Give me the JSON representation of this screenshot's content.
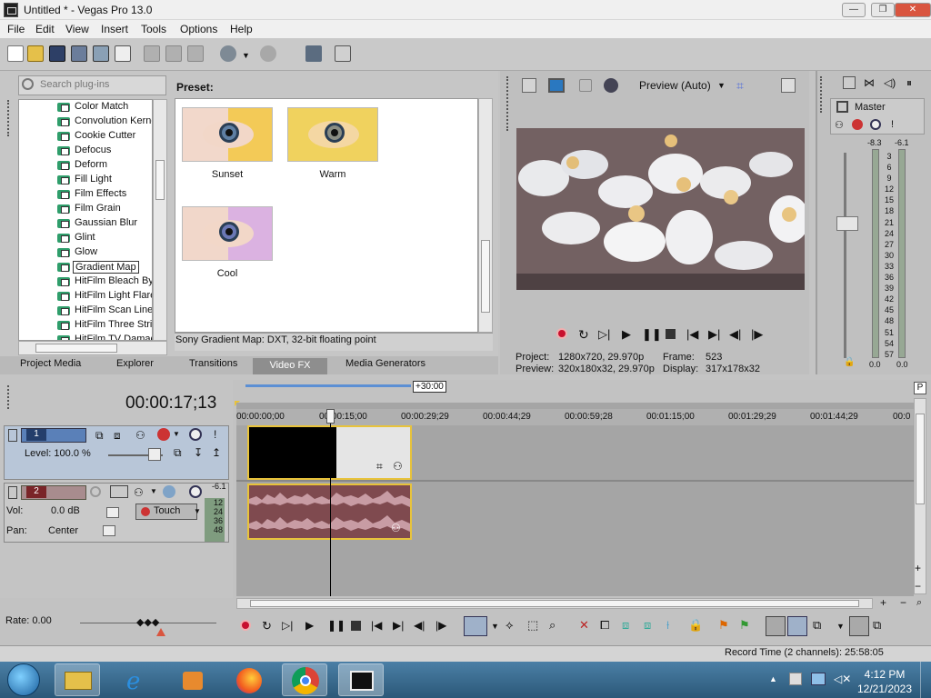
{
  "window": {
    "title": "Untitled * - Vegas Pro 13.0"
  },
  "menu": [
    "File",
    "Edit",
    "View",
    "Insert",
    "Tools",
    "Options",
    "Help"
  ],
  "fx_browser": {
    "search_placeholder": "Search plug-ins",
    "items": [
      "Color Match",
      "Convolution Kerne",
      "Cookie Cutter",
      "Defocus",
      "Deform",
      "Fill Light",
      "Film Effects",
      "Film Grain",
      "Gaussian Blur",
      "Glint",
      "Glow",
      "Gradient Map",
      "HitFilm Bleach Byp",
      "HitFilm Light Flares",
      "HitFilm Scan Lines",
      "HitFilm Three Strip",
      "HitFilm TV Damage"
    ],
    "selected": "Gradient Map",
    "preset_label": "Preset:",
    "presets": [
      {
        "name": "Sunset",
        "tint": "#f3c73a"
      },
      {
        "name": "Warm",
        "tint": "#f0d25e"
      },
      {
        "name": "Cool",
        "tint": "#d6a9e6"
      }
    ],
    "status": "Sony Gradient Map: DXT, 32-bit floating point",
    "tabs": [
      "Project Media",
      "Explorer",
      "Transitions",
      "Video FX",
      "Media Generators"
    ],
    "active_tab": "Video FX"
  },
  "preview": {
    "mode_label": "Preview (Auto)",
    "project_label": "Project:",
    "project_value": "1280x720, 29.970p",
    "preview_label": "Preview:",
    "preview_value": "320x180x32, 29.970p",
    "frame_label": "Frame:",
    "frame_value": "523",
    "display_label": "Display:",
    "display_value": "317x178x32"
  },
  "master": {
    "label": "Master",
    "peak_left": "-8.3",
    "peak_right": "-6.1",
    "scale": [
      "3",
      "6",
      "9",
      "12",
      "15",
      "18",
      "21",
      "24",
      "27",
      "30",
      "33",
      "36",
      "39",
      "42",
      "45",
      "48",
      "51",
      "54",
      "57"
    ],
    "bottom_left": "0.0",
    "bottom_right": "0.0"
  },
  "timeline": {
    "timecode": "00:00:17;13",
    "offset_badge": "+30:00",
    "ruler": [
      "00:00:00;00",
      "00:00:15;00",
      "00:00:29;29",
      "00:00:44;29",
      "00:00:59;28",
      "00:01:15;00",
      "00:01:29;29",
      "00:01:44;29",
      "00:0"
    ],
    "track1": {
      "number": "1",
      "level_label": "Level: 100.0 %"
    },
    "track2": {
      "number": "2",
      "vol_label": "Vol:",
      "vol_value": "0.0 dB",
      "pan_label": "Pan:",
      "pan_value": "Center",
      "touch_label": "Touch",
      "meter_peak": "-6.1",
      "meter_scale": [
        "12",
        "24",
        "36",
        "48"
      ]
    },
    "rate_label": "Rate: 0.00"
  },
  "status_bar": {
    "record_time": "Record Time (2 channels): 25:58:05"
  },
  "taskbar": {
    "time": "4:12 PM",
    "date": "12/21/2023"
  }
}
